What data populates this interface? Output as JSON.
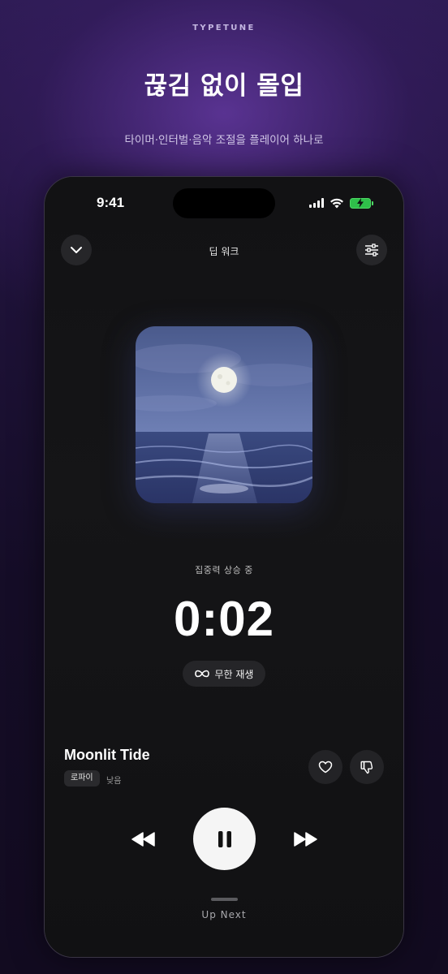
{
  "promo": {
    "brand": "TYPETUNE",
    "headline": "끊김 없이 몰입",
    "subline": "타이머·인터벌·음악 조절을 플레이어 하나로"
  },
  "status_bar": {
    "time": "9:41",
    "icons": [
      "signal-icon",
      "wifi-icon",
      "battery-charging-icon"
    ]
  },
  "nav": {
    "title": "딥 워크",
    "left_icon": "chevron-down-icon",
    "right_icon": "sliders-icon"
  },
  "session": {
    "status": "집중력 상승 중",
    "elapsed": "0:02",
    "loop_label": "무한 재생"
  },
  "track": {
    "title": "Moonlit Tide",
    "genre": "로파이",
    "intensity": "낮음"
  },
  "controls": {
    "rewind": "rewind-icon",
    "pause": "pause-icon",
    "forward": "fast-forward-icon"
  },
  "queue": {
    "label": "Up Next"
  },
  "colors": {
    "accent": "#6a3caa",
    "phone_bg": "#121214",
    "pill_bg": "#252528"
  }
}
